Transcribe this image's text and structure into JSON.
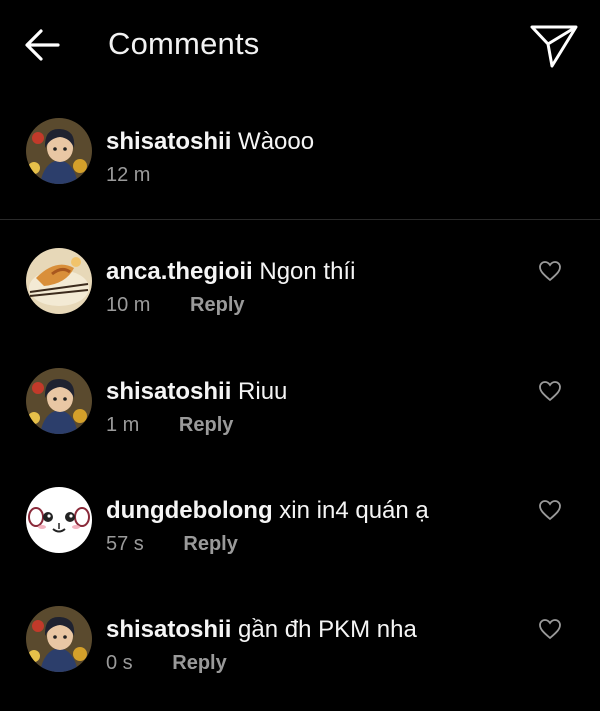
{
  "header": {
    "title": "Comments",
    "back_icon": "arrow-left-icon",
    "send_icon": "paper-plane-icon"
  },
  "caption": {
    "username": "shisatoshii",
    "text": "Wàooo",
    "time": "12 m",
    "avatar": "user-avatar-anime"
  },
  "comments": [
    {
      "username": "anca.thegioii",
      "text": "Ngon thíi",
      "time": "10 m",
      "reply_label": "Reply",
      "avatar": "food-avatar"
    },
    {
      "username": "shisatoshii",
      "text": "Riuu",
      "time": "1 m",
      "reply_label": "Reply",
      "avatar": "user-avatar-anime"
    },
    {
      "username": "dungdebolong",
      "text": "xin in4 quán ạ",
      "time": "57 s",
      "reply_label": "Reply",
      "avatar": "cartoon-face-avatar"
    },
    {
      "username": "shisatoshii",
      "text": "gần đh PKM nha",
      "time": "0 s",
      "reply_label": "Reply",
      "avatar": "user-avatar-anime"
    }
  ],
  "colors": {
    "background": "#000000",
    "text_primary": "#f5f5f5",
    "text_secondary": "#9a9a9a",
    "divider": "#2a2a2a"
  }
}
